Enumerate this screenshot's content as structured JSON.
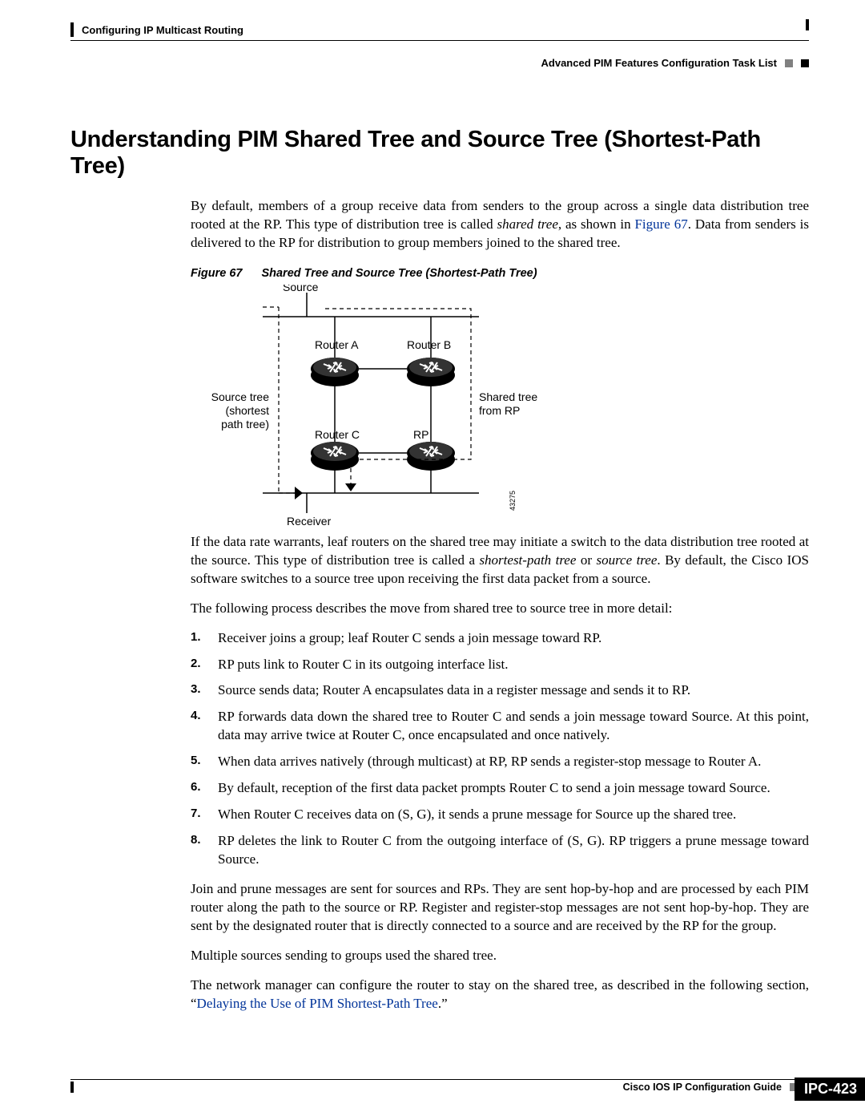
{
  "header": {
    "left_chapter": "Configuring IP Multicast Routing",
    "right_section": "Advanced PIM Features Configuration Task List"
  },
  "title": "Understanding PIM Shared Tree and Source Tree (Shortest-Path Tree)",
  "intro_pre": "By default, members of a group receive data from senders to the group across a single data distribution tree rooted at the RP. This type of distribution tree is called ",
  "intro_shared": "shared tree",
  "intro_mid": ", as shown in ",
  "intro_figref": "Figure 67",
  "intro_post": ". Data from senders is delivered to the RP for distribution to group members joined to the shared tree.",
  "figure": {
    "label": "Figure 67",
    "caption": "Shared Tree and Source Tree (Shortest-Path Tree)",
    "labels": {
      "source": "Source",
      "router_a": "Router A",
      "router_b": "Router B",
      "router_c": "Router C",
      "rp": "RP",
      "receiver": "Receiver",
      "source_tree_l1": "Source tree",
      "source_tree_l2": "(shortest",
      "source_tree_l3": "path tree)",
      "shared_tree_l1": "Shared tree",
      "shared_tree_l2": "from RP",
      "id": "43275"
    }
  },
  "para2_pre": "If the data rate warrants, leaf routers on the shared tree may initiate a switch to the data distribution tree rooted at the source. This type of distribution tree is called a ",
  "para2_spt": "shortest-path tree",
  "para2_or": " or ",
  "para2_src": "source tree",
  "para2_post": ". By default, the Cisco IOS software switches to a source tree upon receiving the first data packet from a source.",
  "para3": "The following process describes the move from shared tree to source tree in more detail:",
  "steps": [
    "Receiver joins a group; leaf Router C sends a join message toward RP.",
    "RP puts link to Router C in its outgoing interface list.",
    "Source sends data; Router A encapsulates data in a register message and sends it to RP.",
    "RP forwards data down the shared tree to Router C and sends a join message toward Source. At this point, data may arrive twice at Router C, once encapsulated and once natively.",
    "When data arrives natively (through multicast) at RP, RP sends a register-stop message to Router A.",
    "By default, reception of the first data packet prompts Router C to send a join message toward Source.",
    "When Router C receives data on (S, G), it sends a prune message for Source up the shared tree.",
    "RP deletes the link to Router C from the outgoing interface of (S, G). RP triggers a prune message toward Source."
  ],
  "para4": "Join and prune messages are sent for sources and RPs. They are sent hop-by-hop and are processed by each PIM router along the path to the source or RP. Register and register-stop messages are not sent hop-by-hop. They are sent by the designated router that is directly connected to a source and are received by the RP for the group.",
  "para5": "Multiple sources sending to groups used the shared tree.",
  "para6_pre": "The network manager can configure the router to stay on the shared tree, as described in the following section, “",
  "para6_link": "Delaying the Use of PIM Shortest-Path Tree",
  "para6_post": ".”",
  "footer": {
    "guide": "Cisco IOS IP Configuration Guide",
    "page": "IPC-423"
  }
}
